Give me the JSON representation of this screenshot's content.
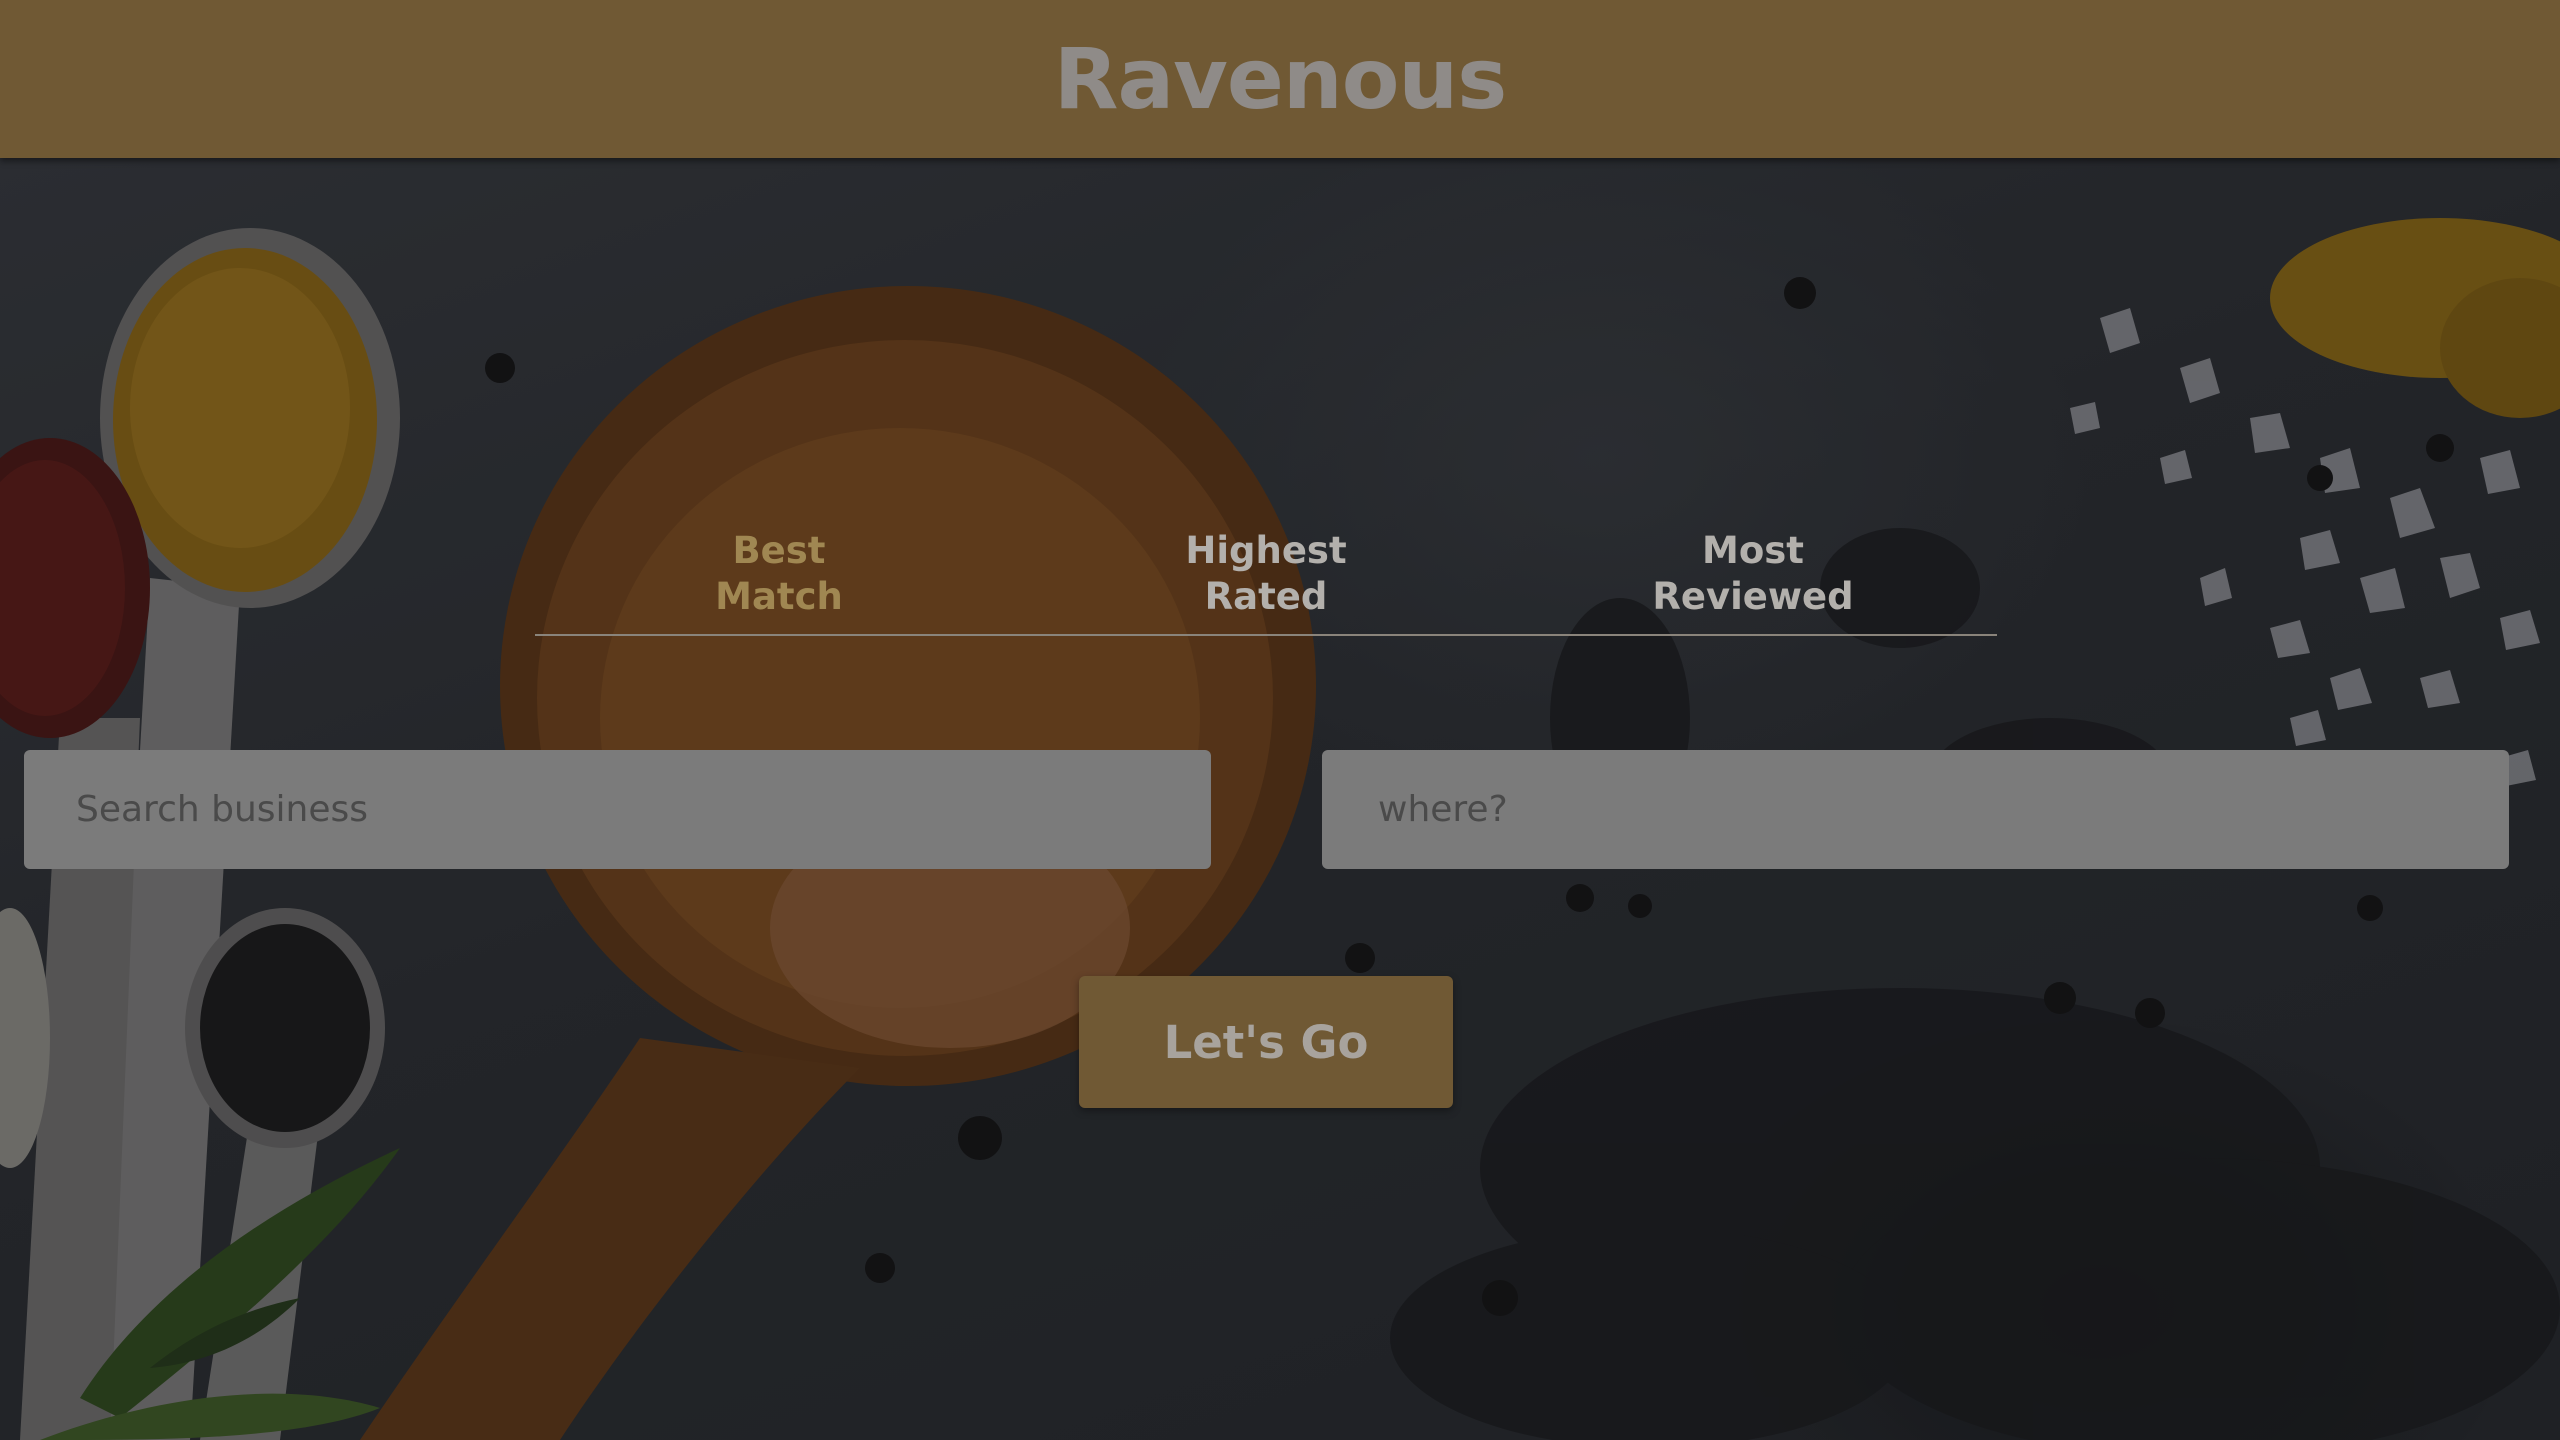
{
  "header": {
    "title": "Ravenous"
  },
  "sort_options": [
    {
      "line1": "Best",
      "line2": "Match",
      "active": true
    },
    {
      "line1": "Highest",
      "line2": "Rated",
      "active": false
    },
    {
      "line1": "Most",
      "line2": "Reviewed",
      "active": false
    }
  ],
  "search": {
    "term_placeholder": "Search business",
    "term_value": "",
    "location_placeholder": "where?",
    "location_value": ""
  },
  "submit": {
    "label": "Let's Go"
  },
  "colors": {
    "header_bg": "#705934",
    "accent_active": "#a08752",
    "button_bg": "#705934",
    "input_bg": "#7b7b7b"
  }
}
